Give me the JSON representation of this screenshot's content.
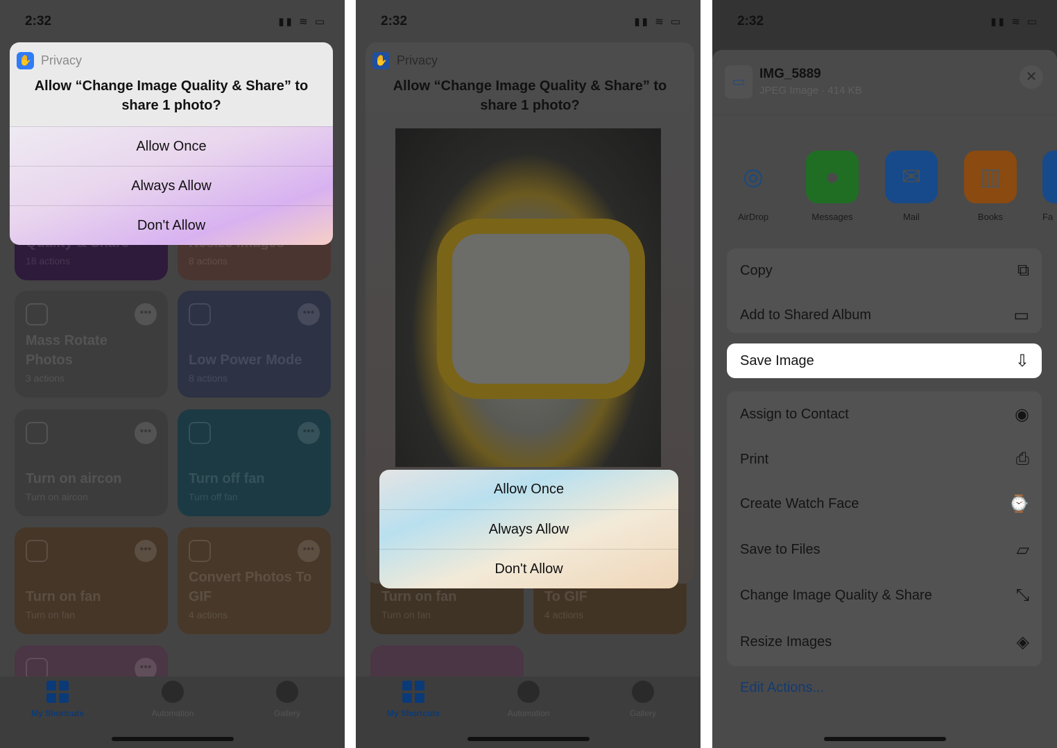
{
  "status": {
    "time": "2:32"
  },
  "panel1": {
    "alert": {
      "source": "Privacy",
      "title": "Allow “Change Image Quality & Share” to share 1 photo?",
      "buttons": [
        "Allow Once",
        "Always Allow",
        "Don't Allow"
      ]
    },
    "cards": [
      {
        "title": "Quality & Share",
        "subtitle": "18 actions",
        "color": "#2e1a3a"
      },
      {
        "title": "Resize Images",
        "subtitle": "8 actions",
        "color": "#4a3530"
      },
      {
        "title": "Mass Rotate Photos",
        "subtitle": "3 actions",
        "color": "#3d3d3d"
      },
      {
        "title": "Low Power Mode",
        "subtitle": "8 actions",
        "color": "#2d3245"
      },
      {
        "title": "Turn on aircon",
        "subtitle": "Turn on aircon",
        "color": "#3c3c3c"
      },
      {
        "title": "Turn off fan",
        "subtitle": "Turn off fan",
        "color": "#1b3a44"
      },
      {
        "title": "Turn on fan",
        "subtitle": "Turn on fan",
        "color": "#453628"
      },
      {
        "title": "Convert Photos To GIF",
        "subtitle": "4 actions",
        "color": "#473829"
      },
      {
        "title": "",
        "subtitle": "",
        "color": "#4a3644"
      }
    ],
    "tabs": [
      "My Shortcuts",
      "Automation",
      "Gallery"
    ]
  },
  "panel2": {
    "alert": {
      "source": "Privacy",
      "title": "Allow “Change Image Quality & Share” to share 1 photo?",
      "buttons": [
        "Allow Once",
        "Always Allow",
        "Don't Allow"
      ]
    },
    "cards": [
      {
        "title": "Turn on fan",
        "subtitle": "Turn on fan",
        "color": "#3f3326"
      },
      {
        "title": "To GIF",
        "subtitle": "4 actions",
        "color": "#423425"
      }
    ],
    "tabs": [
      "My Shortcuts",
      "Automation",
      "Gallery"
    ]
  },
  "panel3": {
    "file": {
      "name": "IMG_5889",
      "meta": "JPEG Image · 414 KB"
    },
    "apps": [
      {
        "label": "AirDrop",
        "color": "#4a4a4a",
        "icon": "airdrop-icon"
      },
      {
        "label": "Messages",
        "color": "#1f6e24",
        "icon": "messages-icon"
      },
      {
        "label": "Mail",
        "color": "#174a8a",
        "icon": "mail-icon"
      },
      {
        "label": "Books",
        "color": "#8a4a10",
        "icon": "books-icon"
      },
      {
        "label": "Fa",
        "color": "#174a8a",
        "icon": "app-icon"
      }
    ],
    "actions": [
      {
        "label": "Copy",
        "icon": "⧉"
      },
      {
        "label": "Add to Shared Album",
        "icon": "▭"
      },
      {
        "label": "Save Image",
        "icon": "⇩"
      },
      {
        "label": "Assign to Contact",
        "icon": "◉"
      },
      {
        "label": "Print",
        "icon": "⎙"
      },
      {
        "label": "Create Watch Face",
        "icon": "⌚"
      },
      {
        "label": "Save to Files",
        "icon": "▱"
      },
      {
        "label": "Change Image Quality & Share",
        "icon": "⤡"
      },
      {
        "label": "Resize Images",
        "icon": "◈"
      }
    ],
    "edit_actions": "Edit Actions..."
  }
}
